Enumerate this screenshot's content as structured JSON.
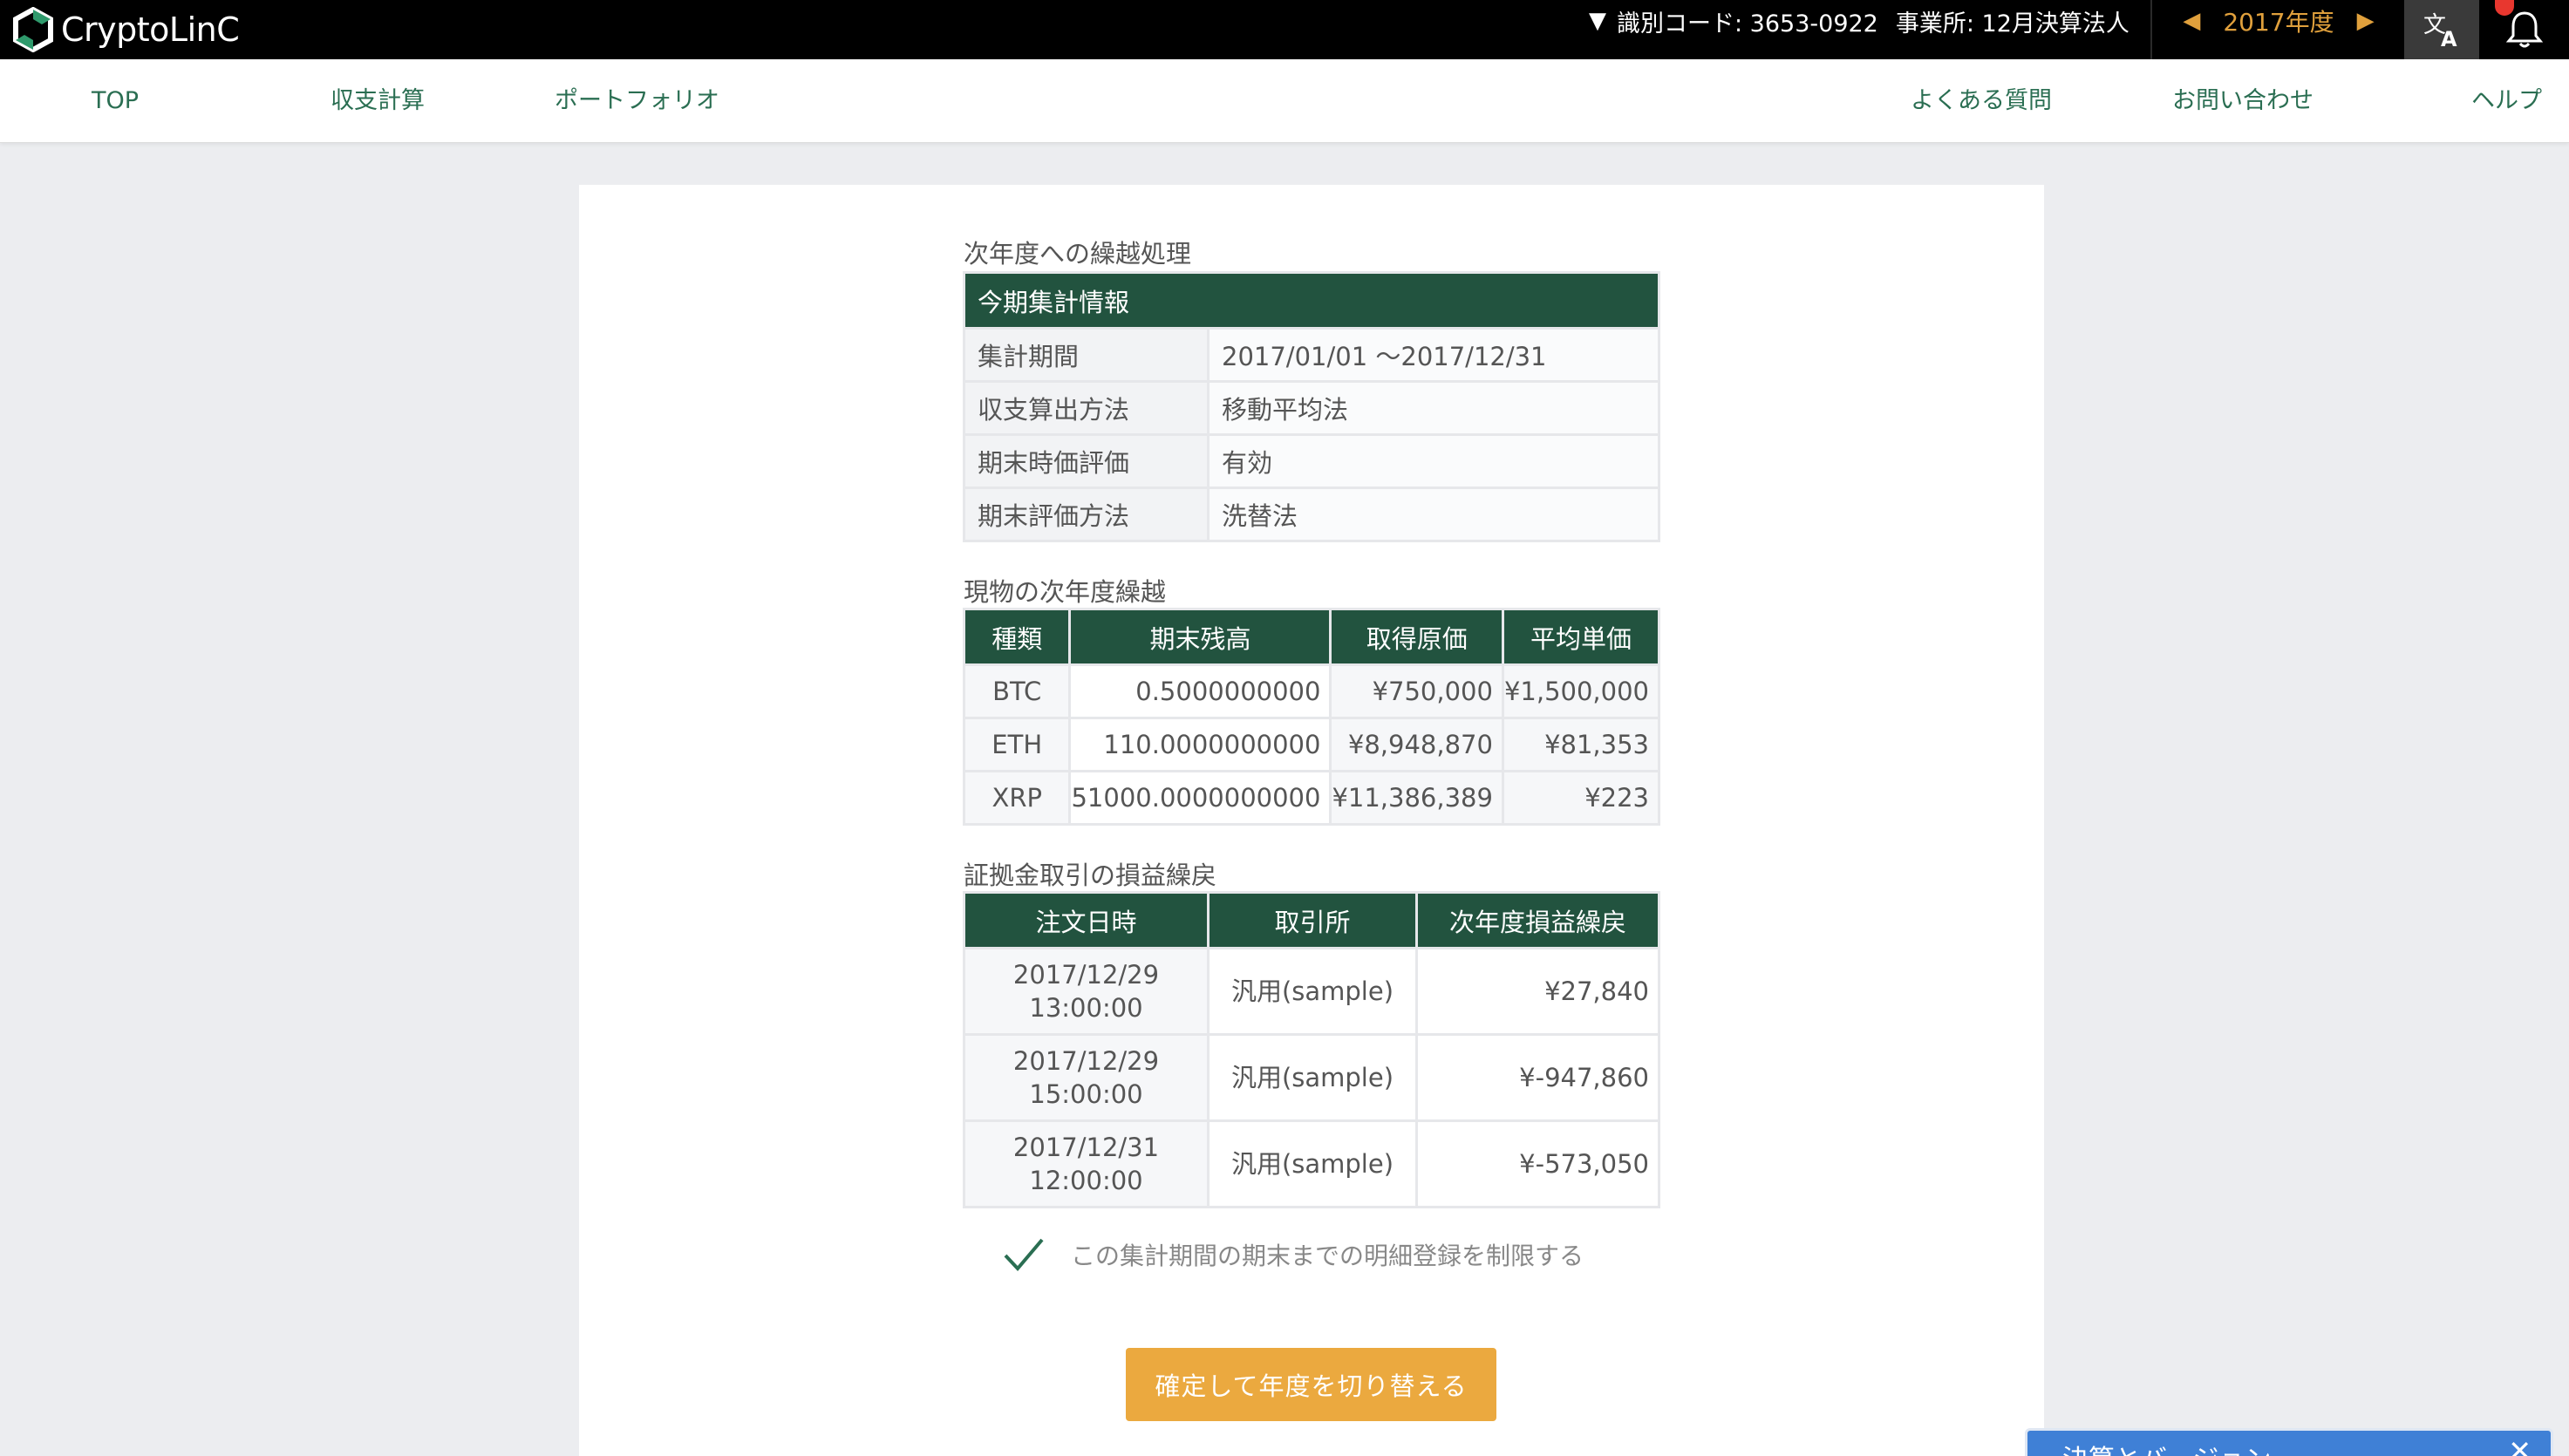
{
  "topbar": {
    "logo_text": "CryptoLinC",
    "id_code": "識別コード: 3653-0922",
    "office": "事業所: 12月決算法人",
    "year": "2017年度",
    "lang_icon": "translate-icon",
    "bell_icon": "bell-icon",
    "colors": {
      "background": "#000000",
      "year_accent": "#e0a03c",
      "badge": "#e8372f"
    }
  },
  "nav": {
    "items": [
      {
        "label": "TOP"
      },
      {
        "label": "収支計算"
      },
      {
        "label": "ポートフォリオ"
      },
      {
        "label": "よくある質問"
      },
      {
        "label": "お問い合わせ"
      },
      {
        "label": "ヘルプ"
      }
    ],
    "color": "#2a6e52"
  },
  "section1": {
    "title": "次年度への繰越処理",
    "table_header": "今期集計情報",
    "rows": [
      {
        "key": "集計期間",
        "value": "2017/01/01 〜2017/12/31"
      },
      {
        "key": "収支算出方法",
        "value": "移動平均法"
      },
      {
        "key": "期末時価評価",
        "value": "有効"
      },
      {
        "key": "期末評価方法",
        "value": "洗替法"
      }
    ]
  },
  "section2": {
    "title": "現物の次年度繰越",
    "columns": [
      "種類",
      "期末残高",
      "取得原価",
      "平均単価"
    ],
    "rows": [
      [
        "BTC",
        "0.5000000000",
        "¥750,000",
        "¥1,500,000"
      ],
      [
        "ETH",
        "110.0000000000",
        "¥8,948,870",
        "¥81,353"
      ],
      [
        "XRP",
        "51000.0000000000",
        "¥11,386,389",
        "¥223"
      ]
    ]
  },
  "section3": {
    "title": "証拠金取引の損益繰戻",
    "columns": [
      "注文日時",
      "取引所",
      "次年度損益繰戻"
    ],
    "rows": [
      {
        "date": "2017/12/29",
        "time": "13:00:00",
        "exchange": "汎用(sample)",
        "amount": "¥27,840"
      },
      {
        "date": "2017/12/29",
        "time": "15:00:00",
        "exchange": "汎用(sample)",
        "amount": "¥-947,860"
      },
      {
        "date": "2017/12/31",
        "time": "12:00:00",
        "exchange": "汎用(sample)",
        "amount": "¥-573,050"
      }
    ]
  },
  "checkbox": {
    "label": "この集計期間の期末までの明細登録を制限する",
    "checked": true,
    "icon": "checkmark-icon"
  },
  "confirm_button": {
    "label": "確定して年度を切り替える",
    "color": "#eba93f"
  },
  "bottom_panel": {
    "title": "決算とバージョン",
    "close_icon": "close-icon"
  },
  "header_color": "#22533f"
}
